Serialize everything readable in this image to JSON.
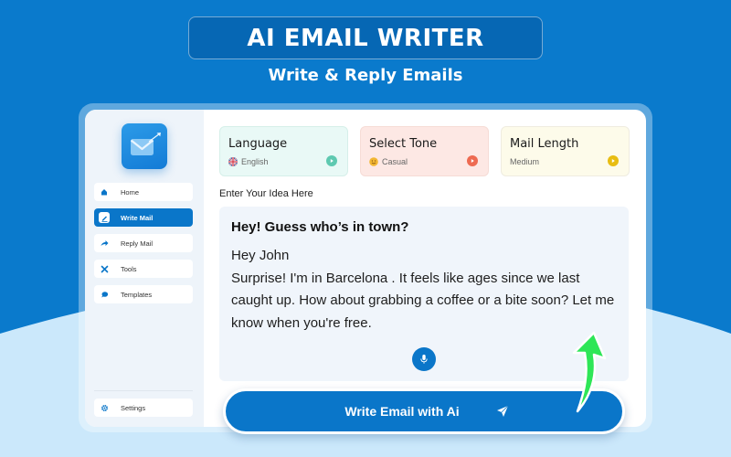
{
  "hero": {
    "title": "AI EMAIL WRITER",
    "subtitle": "Write & Reply Emails"
  },
  "colors": {
    "brand_blue": "#0a76c9",
    "background_top": "#0a7acc",
    "background_bottom": "#cbe8fb",
    "language_card": "#e9f9f6",
    "tone_card": "#fde8e4",
    "length_card": "#fdfbea",
    "language_accent": "#5ec9b0",
    "tone_accent": "#ee6a51",
    "length_accent": "#e8bd12",
    "arrow_green": "#2ee657"
  },
  "sidebar": {
    "logo": "mail-send-icon",
    "items": [
      {
        "label": "Home",
        "icon": "home-icon",
        "active": false
      },
      {
        "label": "Write Mail",
        "icon": "pencil-icon",
        "active": true
      },
      {
        "label": "Reply Mail",
        "icon": "reply-arrow-icon",
        "active": false
      },
      {
        "label": "Tools",
        "icon": "tools-icon",
        "active": false
      },
      {
        "label": "Templates",
        "icon": "templates-icon",
        "active": false
      }
    ],
    "settings": {
      "label": "Settings",
      "icon": "gear-icon"
    }
  },
  "options": {
    "language": {
      "title": "Language",
      "value": "English",
      "icon": "uk-flag-icon"
    },
    "tone": {
      "title": "Select Tone",
      "value": "Casual",
      "icon": "smiley-icon"
    },
    "length": {
      "title": "Mail Length",
      "value": "Medium"
    }
  },
  "editor": {
    "label": "Enter Your Idea Here",
    "subject": "Hey! Guess who’s in town?",
    "greeting": "Hey John",
    "body": "Surprise! I'm in Barcelona . It feels like ages since we last caught up. How about grabbing a coffee or a bite soon? Let me know when you're free."
  },
  "cta": {
    "label": "Write Email with Ai",
    "icon": "send-icon"
  }
}
